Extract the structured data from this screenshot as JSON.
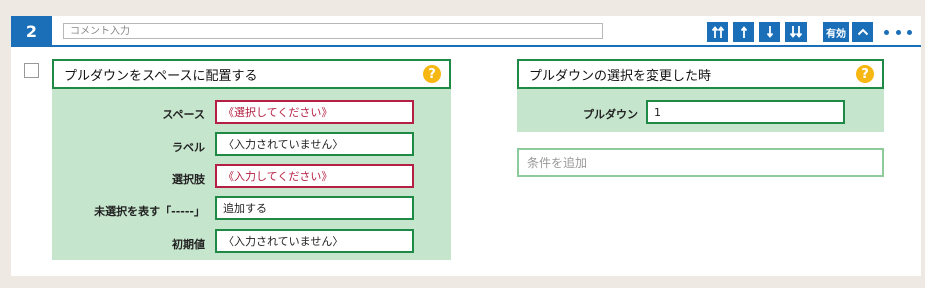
{
  "header": {
    "number": "2",
    "comment_placeholder": "コメント入力",
    "enabled_label": "有効"
  },
  "left_panel": {
    "title": "プルダウンをスペースに配置する",
    "help": "?",
    "rows": [
      {
        "label": "スペース",
        "value": "《選択してください》",
        "required": true
      },
      {
        "label": "ラベル",
        "value": "〈入力されていません〉",
        "required": false
      },
      {
        "label": "選択肢",
        "value": "《入力してください》",
        "required": true
      },
      {
        "label": "未選択を表す「-----」",
        "value": "追加する",
        "required": false
      },
      {
        "label": "初期値",
        "value": "〈入力されていません〉",
        "required": false
      }
    ]
  },
  "right_panel": {
    "title": "プルダウンの選択を変更した時",
    "help": "?",
    "row": {
      "label": "プルダウン",
      "value": "1"
    }
  },
  "add_condition_placeholder": "条件を追加",
  "colors": {
    "primary_blue": "#1a6fb8",
    "panel_green_bg": "#c6e5cd",
    "border_green": "#1f8a45",
    "required_red": "#b51f43",
    "help_yellow": "#f6b712"
  },
  "icons": {
    "move_top": "double-arrow-up-icon",
    "move_up": "arrow-up-icon",
    "move_down": "arrow-down-icon",
    "move_bottom": "double-arrow-down-icon",
    "collapse": "chevron-up-icon",
    "more": "more-horizontal-icon",
    "help": "question-circle-icon"
  }
}
